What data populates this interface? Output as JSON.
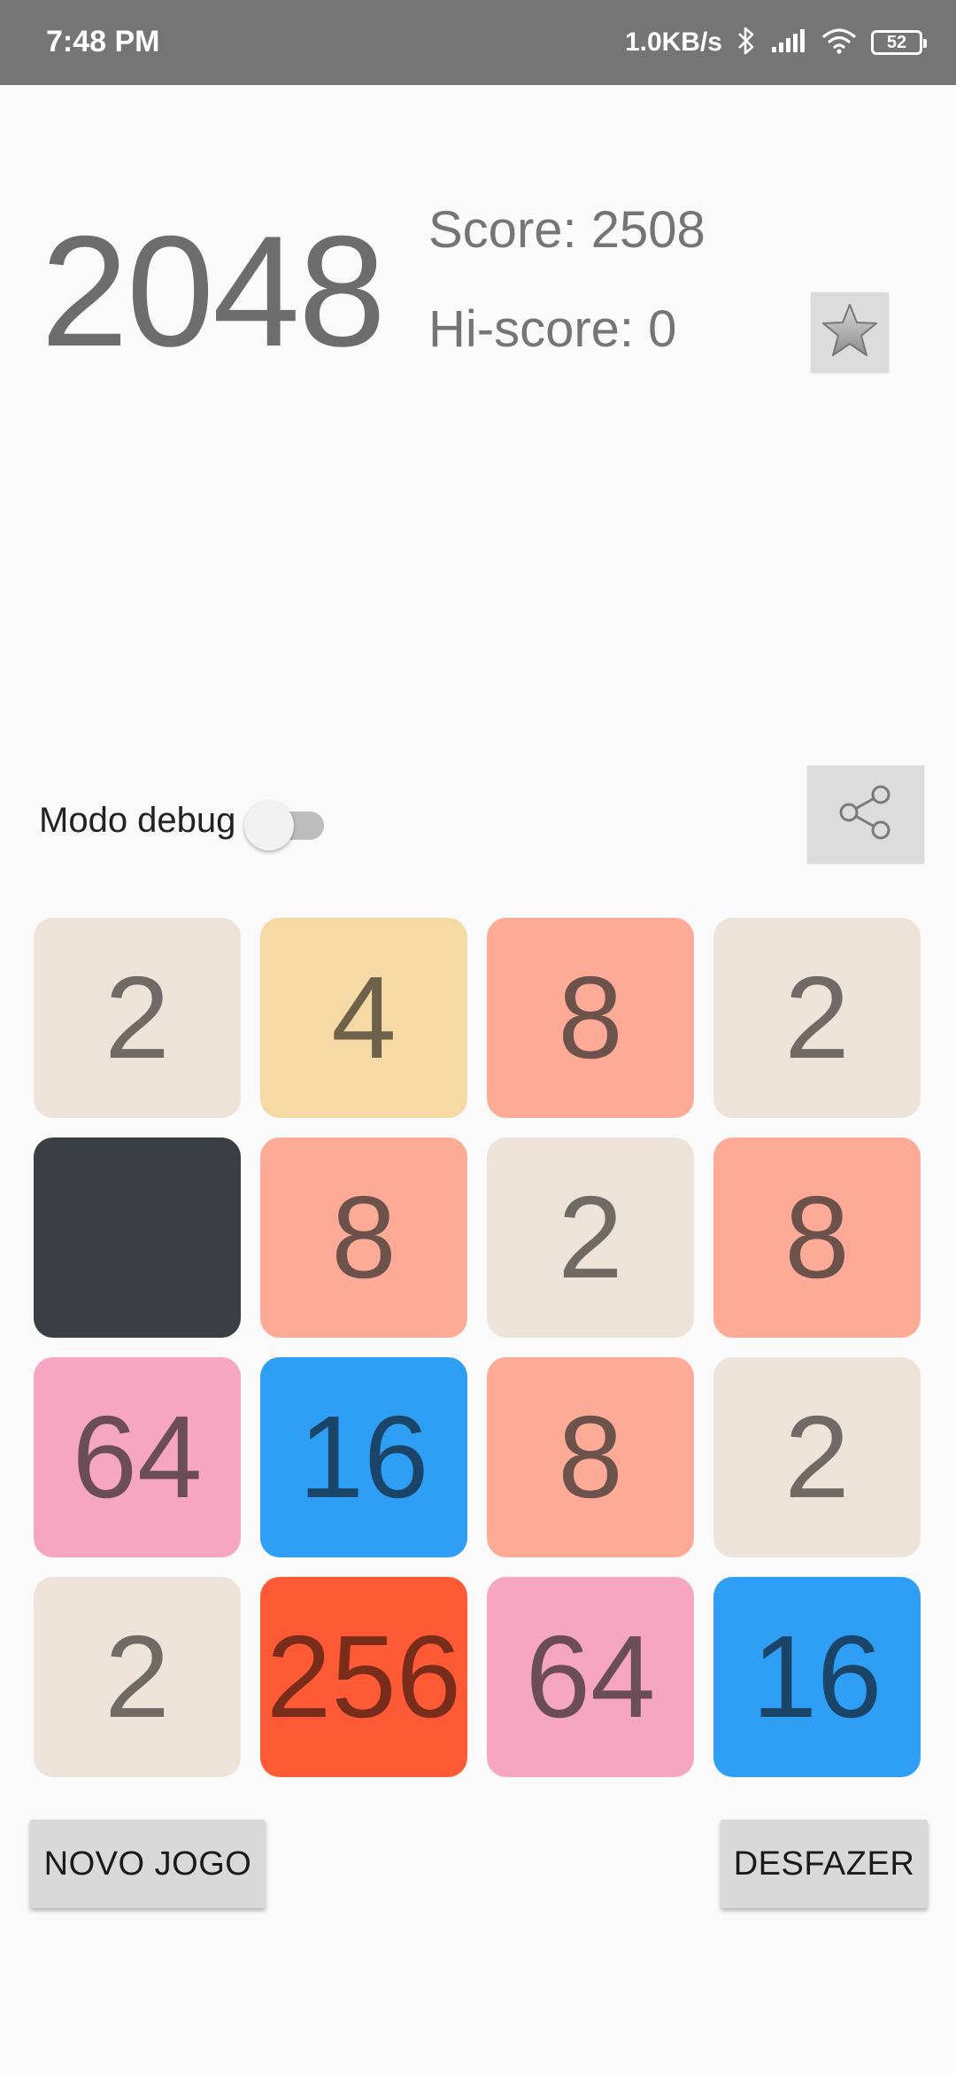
{
  "status_bar": {
    "time": "7:48 PM",
    "net_speed": "1.0KB/s",
    "battery": "52",
    "icons": [
      "bluetooth-icon",
      "signal-icon",
      "wifi-icon",
      "battery-icon"
    ]
  },
  "header": {
    "title": "2048",
    "score": "Score: 2508",
    "hiscore": "Hi-score: 0",
    "star_icon": "star-icon"
  },
  "controls": {
    "debug_label": "Modo debug",
    "debug_enabled": false,
    "share_icon": "share-icon"
  },
  "board": {
    "rows": [
      [
        {
          "value": "2",
          "bg": "#ede3d9",
          "fg": "#6f6a66"
        },
        {
          "value": "4",
          "bg": "#f5daa6",
          "fg": "#6e624a"
        },
        {
          "value": "8",
          "bg": "#fdab97",
          "fg": "#6d524c"
        },
        {
          "value": "2",
          "bg": "#ede3d9",
          "fg": "#6f6a66"
        }
      ],
      [
        {
          "value": "",
          "bg": "#3b3e42",
          "fg": "#3b3e42"
        },
        {
          "value": "8",
          "bg": "#fdab97",
          "fg": "#6d524c"
        },
        {
          "value": "2",
          "bg": "#ede3d9",
          "fg": "#6f6a66"
        },
        {
          "value": "8",
          "bg": "#fdab97",
          "fg": "#6d524c"
        }
      ],
      [
        {
          "value": "64",
          "bg": "#f6a6c1",
          "fg": "#6b4d58"
        },
        {
          "value": "16",
          "bg": "#2f9ff5",
          "fg": "#1a4568"
        },
        {
          "value": "8",
          "bg": "#fdab97",
          "fg": "#6d524c"
        },
        {
          "value": "2",
          "bg": "#ede3d9",
          "fg": "#6f6a66"
        }
      ],
      [
        {
          "value": "2",
          "bg": "#ede3d9",
          "fg": "#6f6a66"
        },
        {
          "value": "256",
          "bg": "#fe5a35",
          "fg": "#7a2c1a"
        },
        {
          "value": "64",
          "bg": "#f6a6c1",
          "fg": "#6b4d58"
        },
        {
          "value": "16",
          "bg": "#2f9ff5",
          "fg": "#1a4568"
        }
      ]
    ]
  },
  "buttons": {
    "new_game": "NOVO JOGO",
    "undo": "DESFAZER"
  }
}
